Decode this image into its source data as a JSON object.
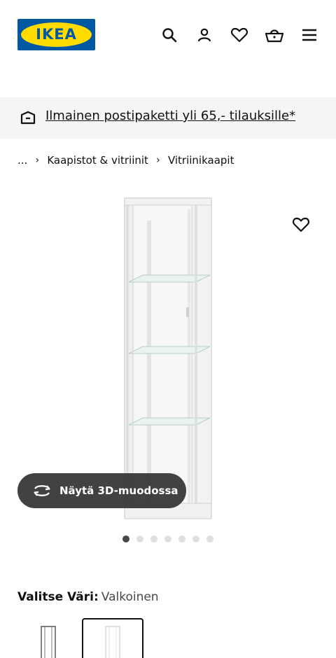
{
  "header": {
    "logo_text": "IKEA",
    "icons": [
      "search-icon",
      "account-icon",
      "heart-icon",
      "basket-icon",
      "menu-icon"
    ]
  },
  "promo": {
    "icon": "delivery-box-icon",
    "text": "Ilmainen postipaketti yli 65,- tilauksille*"
  },
  "breadcrumb": {
    "items": [
      "...",
      "Kaapistot & vitriinit",
      "Vitriinikaapit"
    ]
  },
  "gallery": {
    "view_3d_label": "Näytä 3D-muodossa",
    "dot_count": 7,
    "active_dot": 0
  },
  "color": {
    "label": "Valitse Väri:",
    "value": "Valkoinen",
    "options": [
      "black-brown",
      "white"
    ],
    "selected": "white"
  },
  "colors": {
    "ikea_blue": "#0058a3",
    "ikea_yellow": "#ffdb00",
    "promo_bg": "#f5f5f5",
    "pill_bg": "#333333"
  }
}
